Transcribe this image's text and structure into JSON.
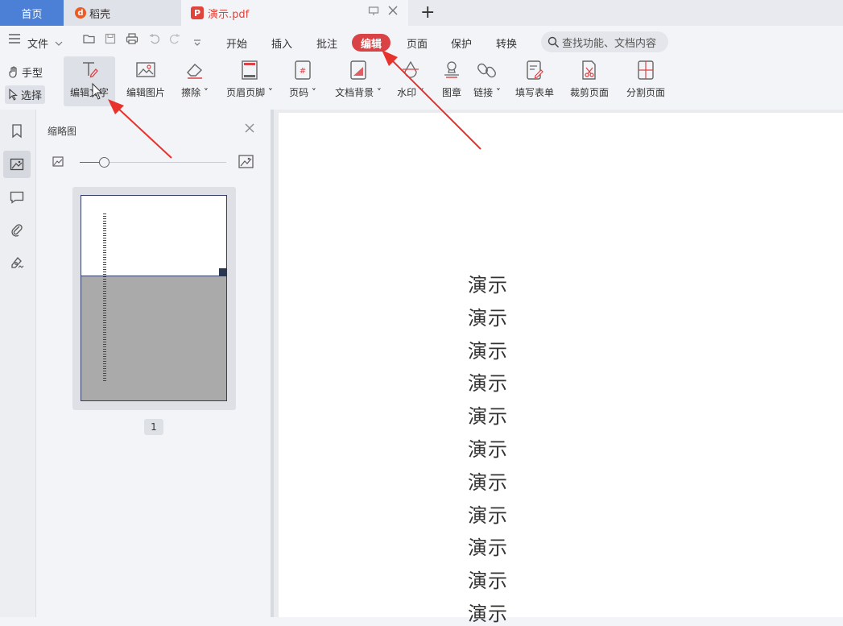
{
  "tabs": {
    "home": "首页",
    "docer": "稻壳",
    "pdf": "演示.pdf",
    "new_tab": "+"
  },
  "menu": {
    "file": "文件",
    "items": [
      "开始",
      "插入",
      "批注",
      "编辑",
      "页面",
      "保护",
      "转换"
    ],
    "active": "编辑",
    "search_placeholder": "查找功能、文档内容"
  },
  "ribbon": {
    "hand_tool": "手型",
    "select_tool": "选择",
    "buttons": [
      "编辑文字",
      "编辑图片",
      "擦除",
      "页眉页脚",
      "页码",
      "文档背景",
      "水印",
      "图章",
      "链接",
      "填写表单",
      "裁剪页面",
      "分割页面"
    ]
  },
  "thumbnail_panel": {
    "title": "缩略图",
    "page_number": "1"
  },
  "document": {
    "lines": [
      "演示",
      "演示",
      "演示",
      "演示",
      "演示",
      "演示",
      "演示",
      "演示",
      "演示",
      "演示",
      "演示"
    ]
  },
  "colors": {
    "accent": "#d94346",
    "home_tab": "#4c7fd6",
    "arrow": "#e8322c"
  }
}
